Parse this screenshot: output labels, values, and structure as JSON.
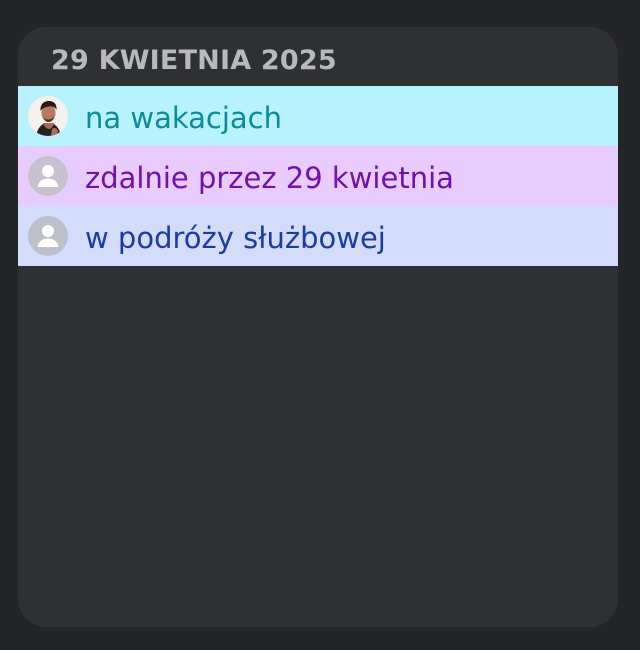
{
  "card": {
    "title": "29 KWIETNIA 2025"
  },
  "statuses": [
    {
      "label": "na wakacjach",
      "avatar": "user-photo-avatar",
      "bg_color": "#b8f2ff",
      "text_color": "#0d8a9c"
    },
    {
      "label": "zdalnie przez 29 kwietnia",
      "avatar": "default-user-avatar",
      "bg_color": "#e8ccff",
      "text_color": "#7010b0"
    },
    {
      "label": "w podróży służbowej",
      "avatar": "default-user-avatar",
      "bg_color": "#d4dcfc",
      "text_color": "#1a3ca8"
    }
  ]
}
